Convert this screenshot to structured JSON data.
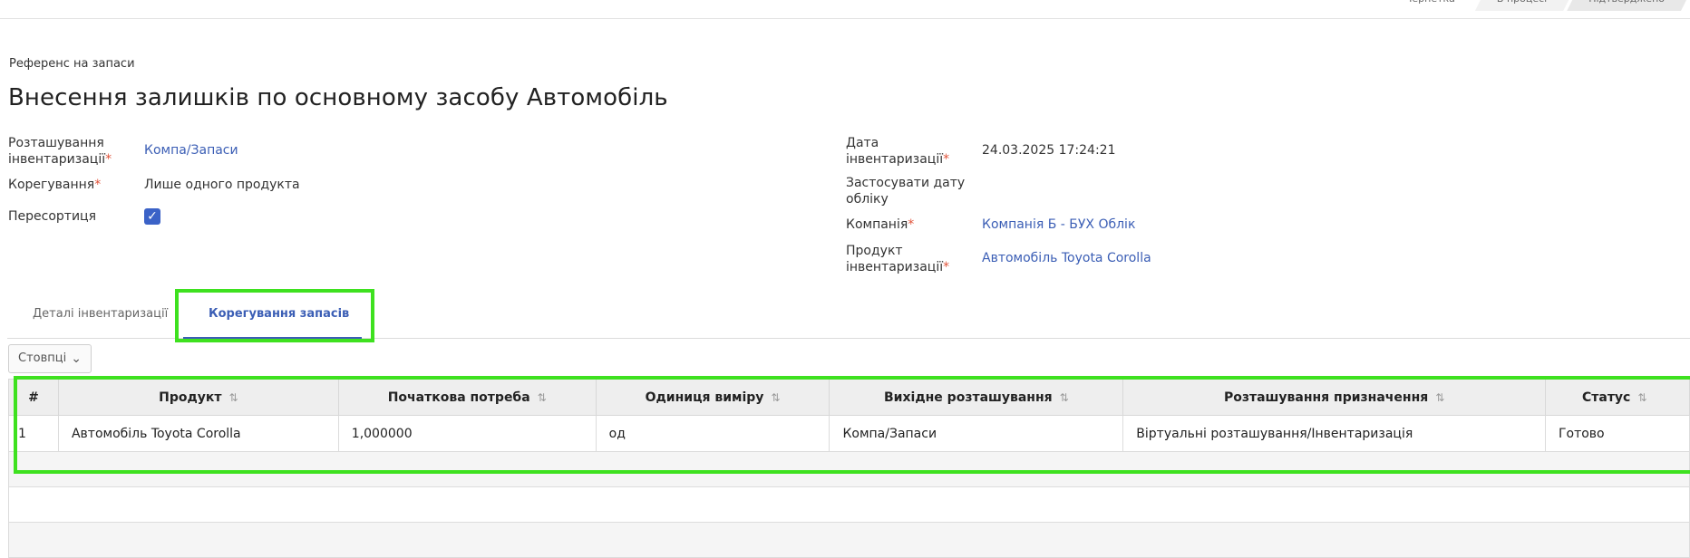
{
  "status_bar": {
    "stages": [
      "Чернетка",
      "В процесі",
      "Підтверджено"
    ]
  },
  "header": {
    "reference": "Референс на запаси",
    "title": "Внесення залишків по основному засобу Автомобіль"
  },
  "form": {
    "location_label_1": "Розташування",
    "location_label_2": "інвентаризації",
    "location_value": "Компа/Запаси",
    "adjustment_label": "Корегування",
    "adjustment_value": "Лише одного продукта",
    "resort_label": "Пересортиця",
    "resort_checked": true,
    "date_label_1": "Дата",
    "date_label_2": "інвентаризації",
    "date_value": "24.03.2025 17:24:21",
    "accounting_label_1": "Застосувати дату",
    "accounting_label_2": "обліку",
    "company_label": "Компанія",
    "company_value": "Компанія Б - БУХ Облік",
    "product_label_1": "Продукт",
    "product_label_2": "інвентаризації",
    "product_value": "Автомобіль Toyota Corolla",
    "required_mark": "*"
  },
  "tabs": {
    "details": "Деталі інвентаризації",
    "adjustments": "Корегування запасів"
  },
  "columns_button": "Стовпці",
  "table": {
    "headers": [
      "#",
      "Продукт",
      "Початкова потреба",
      "Одиниця виміру",
      "Вихідне розташування",
      "Розташування призначення",
      "Статус"
    ],
    "rows": [
      [
        "1",
        "Автомобіль Toyota Corolla",
        "1,000000",
        "од",
        "Компа/Запаси",
        "Віртуальні розташування/Інвентаризація",
        "Готово"
      ]
    ]
  }
}
